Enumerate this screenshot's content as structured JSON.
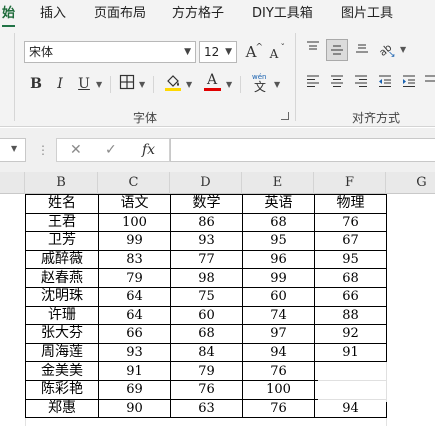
{
  "tabs": [
    "始",
    "插入",
    "页面布局",
    "方方格子",
    "DIY工具箱",
    "图片工具"
  ],
  "font": {
    "name": "宋体",
    "size": "12",
    "grow_label": "A",
    "shrink_label": "A",
    "bold": "B",
    "italic": "I",
    "underline": "U",
    "font_color_label": "A",
    "phonetic_top": "wén",
    "phonetic_bottom": "文",
    "group_label": "字体",
    "fill_color": "#ffd800",
    "font_color": "#e00000"
  },
  "alignment": {
    "group_label": "对齐方式",
    "orientation_label": "ab"
  },
  "formula_bar": {
    "fx_label": "fx"
  },
  "columns": [
    "B",
    "C",
    "D",
    "E",
    "F",
    "G"
  ],
  "table": {
    "headers": [
      "姓名",
      "语文",
      "数学",
      "英语",
      "物理"
    ],
    "rows": [
      [
        "王君",
        "100",
        "86",
        "68",
        "76"
      ],
      [
        "卫芳",
        "99",
        "93",
        "95",
        "67"
      ],
      [
        "戚醉薇",
        "83",
        "77",
        "96",
        "95"
      ],
      [
        "赵春燕",
        "79",
        "98",
        "99",
        "68"
      ],
      [
        "沈明珠",
        "64",
        "75",
        "60",
        "66"
      ],
      [
        "许珊",
        "64",
        "60",
        "74",
        "88"
      ],
      [
        "张大芬",
        "66",
        "68",
        "97",
        "92"
      ],
      [
        "周海莲",
        "93",
        "84",
        "94",
        "91"
      ],
      [
        "金美美",
        "91",
        "79",
        "76",
        ""
      ],
      [
        "陈彩艳",
        "69",
        "76",
        "100",
        ""
      ],
      [
        "郑惠",
        "90",
        "63",
        "76",
        "94"
      ]
    ]
  }
}
